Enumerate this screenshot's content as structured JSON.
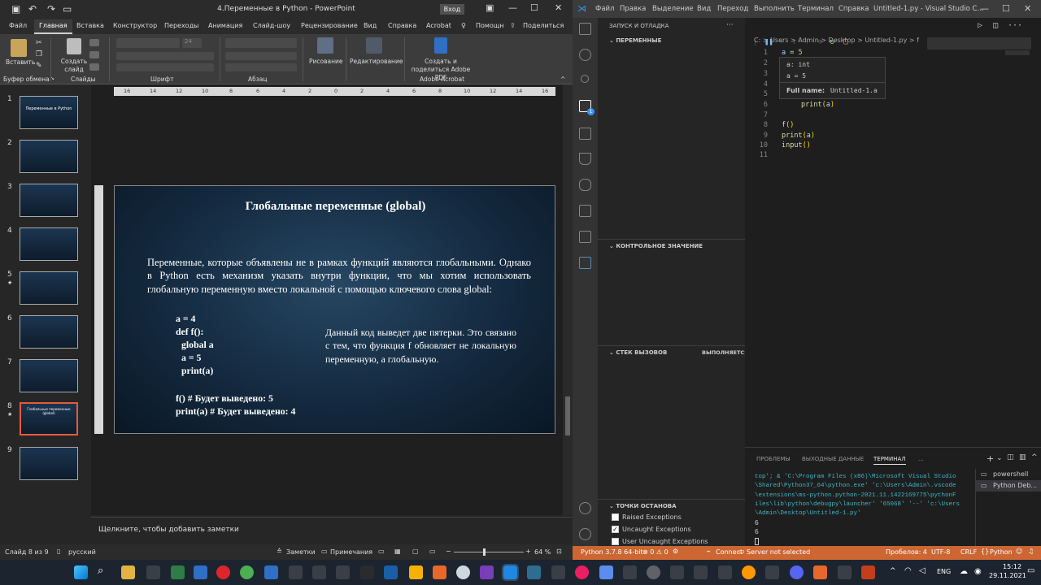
{
  "ppt": {
    "title": "4.Переменные в Python  -  PowerPoint",
    "login": "Вход",
    "tabs": [
      "Файл",
      "Главная",
      "Вставка",
      "Конструктор",
      "Переходы",
      "Анимация",
      "Слайд-шоу",
      "Рецензирование",
      "Вид",
      "Справка",
      "Acrobat",
      "Помощн",
      "Поделиться"
    ],
    "ribbon": {
      "paste": "Вставить",
      "create_slide": "Создать слайд",
      "drawing": "Рисование",
      "editing": "Редактирование",
      "adobe": "Создать и поделиться Adobe PDF",
      "font_size": "24",
      "groups": [
        "Буфер обмена",
        "Слайды",
        "Шрифт",
        "Абзац",
        "Adobe Acrobat"
      ]
    },
    "thumbs": [
      {
        "num": "1",
        "text": "Переменные в Python"
      },
      {
        "num": "2",
        "text": ""
      },
      {
        "num": "3",
        "text": ""
      },
      {
        "num": "4",
        "text": ""
      },
      {
        "num": "5",
        "text": ""
      },
      {
        "num": "6",
        "text": ""
      },
      {
        "num": "7",
        "text": ""
      },
      {
        "num": "8",
        "text": "Глобальные переменные (global)"
      },
      {
        "num": "9",
        "text": ""
      }
    ],
    "ruler": [
      "16",
      "14",
      "12",
      "10",
      "8",
      "6",
      "4",
      "2",
      "0",
      "2",
      "4",
      "6",
      "8",
      "10",
      "12",
      "14",
      "16"
    ],
    "slide": {
      "title": "Глобальные переменные (global)",
      "para": "Переменные, которые объявлены не в рамках функций являются глобальными. Однако в Python есть механизм указать внутри функции, что мы хотим использовать глобальную переменную вместо локальной с помощью ключевого слова global:",
      "code": [
        "a = 4",
        "def f():",
        "global a",
        "a = 5",
        "print(a)",
        "f() # Будет выведено: 5",
        "print(a) # Будет выведено: 4"
      ],
      "note": "Данный код выведет две пятерки. Это связано с тем, что функция f обновляет не локальную переменную, а глобальную."
    },
    "notes": "Щелкните, чтобы добавить заметки",
    "status": {
      "slide": "Слайд 8 из 9",
      "lang": "русский",
      "notes": "Заметки",
      "comments": "Примечания",
      "zoom": "64 %"
    }
  },
  "vsc": {
    "menu": [
      "Файл",
      "Правка",
      "Выделение",
      "Вид",
      "Переход",
      "Выполнить",
      "Терминал",
      "Справка"
    ],
    "title": "Untitled-1.py - Visual Studio C...",
    "side": {
      "header": "ЗАПУСК И ОТЛАДКА",
      "variables": "ПЕРЕМЕННЫЕ",
      "watch": "КОНТРОЛЬНОЕ ЗНАЧЕНИЕ",
      "callstack": "СТЕК ВЫЗОВОВ",
      "running": "ВЫПОЛНЯЕТСЯ",
      "breakpoints": "ТОЧКИ ОСТАНОВА",
      "bp_items": [
        "Raised Exceptions",
        "Uncaught Exceptions",
        "User Uncaught Exceptions"
      ]
    },
    "breadcrumb": "C: > Users > Admin > Desktop > Untitled-1.py > f",
    "line_numbers": [
      "1",
      "2",
      "3",
      "4",
      "5",
      "6",
      "7",
      "8",
      "9",
      "10",
      "11"
    ],
    "hover": {
      "type": "a: int",
      "value": "a = 5",
      "fullname_label": "Full name:",
      "fullname": "Untitled-1.a"
    },
    "panel_tabs": [
      "ПРОБЛЕМЫ",
      "ВЫХОДНЫЕ ДАННЫЕ",
      "ТЕРМИНАЛ",
      "..."
    ],
    "terminal": "top'; & 'C:\\Program Files (x86)\\Microsoft Visual Studio\n\\Shared\\Python37_64\\python.exe' 'c:\\Users\\Admin\\.vscode\n\\extensions\\ms-python.python-2021.11.1422169775\\pythonF\niles\\lib\\python\\debugpy\\launcher' '65068' '--' 'c:\\Users\n\\Admin\\Desktop\\Untitled-1.py'",
    "term_out": [
      "6",
      "6"
    ],
    "term_list": [
      "powershell",
      "Python Deb..."
    ],
    "status": {
      "python": "Python 3.7.8 64-bit",
      "errors": "⊗ 0 ⚠ 0",
      "connect": "Connect",
      "server": "Server not selected",
      "spaces": "Пробелов: 4",
      "enc": "UTF-8",
      "eol": "CRLF",
      "lang": "Python"
    }
  },
  "taskbar": {
    "lang": "ENG",
    "time": "15:12",
    "date": "29.11.2021"
  }
}
